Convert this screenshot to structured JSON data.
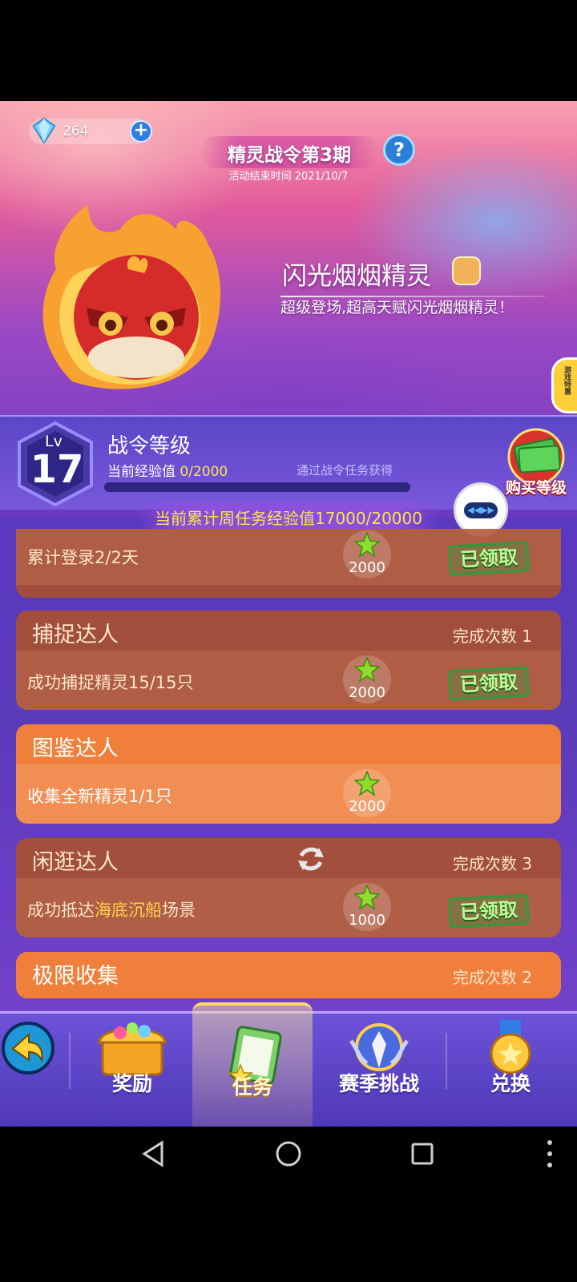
{
  "currency": {
    "gems": "264"
  },
  "season": {
    "title": "精灵战令第3期",
    "end_time": "活动结束时间 2021/10/7",
    "help": "?"
  },
  "featured": {
    "name": "闪光烟烟精灵",
    "description": "超级登场,超高天赋闪光烟烟精灵！",
    "side_tab": "游戏特惠"
  },
  "level": {
    "lv_prefix": "Lv",
    "number": "17",
    "label": "战令等级",
    "exp_label": "当前经验值 ",
    "exp_value": "0/2000",
    "exp_progress": 0,
    "exp_hint": "通过战令任务获得",
    "buy_label": "购买等级"
  },
  "weekly": {
    "text": "当前累计周任务经验值17000/20000"
  },
  "tasks": [
    {
      "title": "",
      "count": "",
      "desc": "累计登录2/2天",
      "exp": "2000",
      "status": "已领取"
    },
    {
      "title": "捕捉达人",
      "count": "完成次数 1",
      "desc": "成功捕捉精灵15/15只",
      "exp": "2000",
      "status": "已领取"
    },
    {
      "title": "图鉴达人",
      "count": "",
      "desc": "收集全新精灵1/1只",
      "exp": "2000",
      "status": ""
    },
    {
      "title": "闲逛达人",
      "count": "完成次数 3",
      "desc_pre": "成功抵达",
      "desc_hl": "海底沉船",
      "desc_post": "场景",
      "exp": "1000",
      "status": "已领取"
    },
    {
      "title": "极限收集",
      "count": "完成次数 2"
    }
  ],
  "nav": {
    "rewards": "奖励",
    "tasks": "任务",
    "season_challenge": "赛季挑战",
    "exchange": "兑换"
  },
  "icons": {
    "gem": "diamond-icon",
    "back": "back-arrow-icon",
    "exp": "exp-star-icon",
    "refresh": "refresh-icon"
  },
  "colors": {
    "accent_yellow": "#ffe34f",
    "task_active": "#f07f3c",
    "task_done": "#a85032"
  }
}
